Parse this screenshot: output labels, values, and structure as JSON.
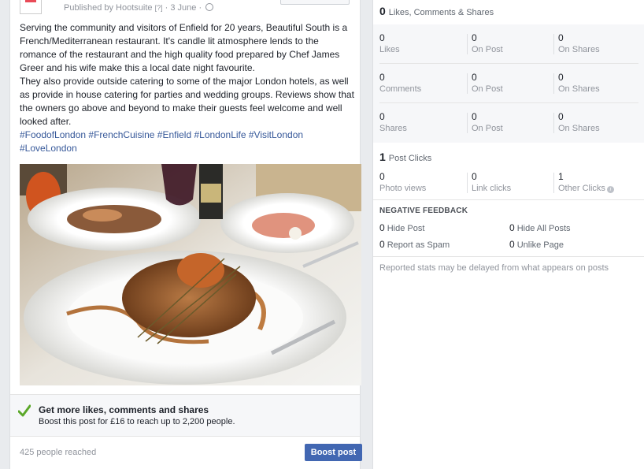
{
  "post": {
    "meta": {
      "publisher": "Published by Hootsuite",
      "help": "[?]",
      "date": "· 3 June ·"
    },
    "text": "Serving the community and visitors of Enfield for 20 years, Beautiful South is a French/Mediterranean restaurant. It's candle lit atmosphere lends to the romance of the restaurant and the high quality food prepared by Chef James Greer and his wife make this a local date night favourite.\nThey also provide outside catering to some of the major London hotels, as well as provide in house catering for parties and wedding groups. Reviews show that the owners go above and beyond to make their guests feel welcome and well looked after.",
    "hashtags": "#FoodofLondon #FrenchCuisine #Enfield #LondonLife #VisitLondon #LoveLondon",
    "promo": {
      "title": "Get more likes, comments and shares",
      "subtitle": "Boost this post for £16 to reach up to 2,200 people."
    },
    "reached": "425 people reached",
    "boost_label": "Boost post"
  },
  "stats": {
    "engagement": {
      "count": "0",
      "label": "Likes, Comments & Shares"
    },
    "rows": [
      {
        "total": "0",
        "total_label": "Likes",
        "on_post": "0",
        "on_post_label": "On Post",
        "on_shares": "0",
        "on_shares_label": "On Shares"
      },
      {
        "total": "0",
        "total_label": "Comments",
        "on_post": "0",
        "on_post_label": "On Post",
        "on_shares": "0",
        "on_shares_label": "On Shares"
      },
      {
        "total": "0",
        "total_label": "Shares",
        "on_post": "0",
        "on_post_label": "On Post",
        "on_shares": "0",
        "on_shares_label": "On Shares"
      }
    ],
    "clicks": {
      "count": "1",
      "label": "Post Clicks",
      "photo_views": "0",
      "photo_views_label": "Photo views",
      "link_clicks": "0",
      "link_clicks_label": "Link clicks",
      "other_clicks": "1",
      "other_clicks_label": "Other Clicks"
    },
    "negative": {
      "title": "NEGATIVE FEEDBACK",
      "hide_post": "0",
      "hide_post_label": "Hide Post",
      "hide_all": "0",
      "hide_all_label": "Hide All Posts",
      "spam": "0",
      "spam_label": "Report as Spam",
      "unlike": "0",
      "unlike_label": "Unlike Page"
    },
    "note": "Reported stats may be delayed from what appears on posts"
  },
  "colors": {
    "accent": "#4267b2",
    "hashtag": "#365899",
    "check": "#5ba829"
  }
}
